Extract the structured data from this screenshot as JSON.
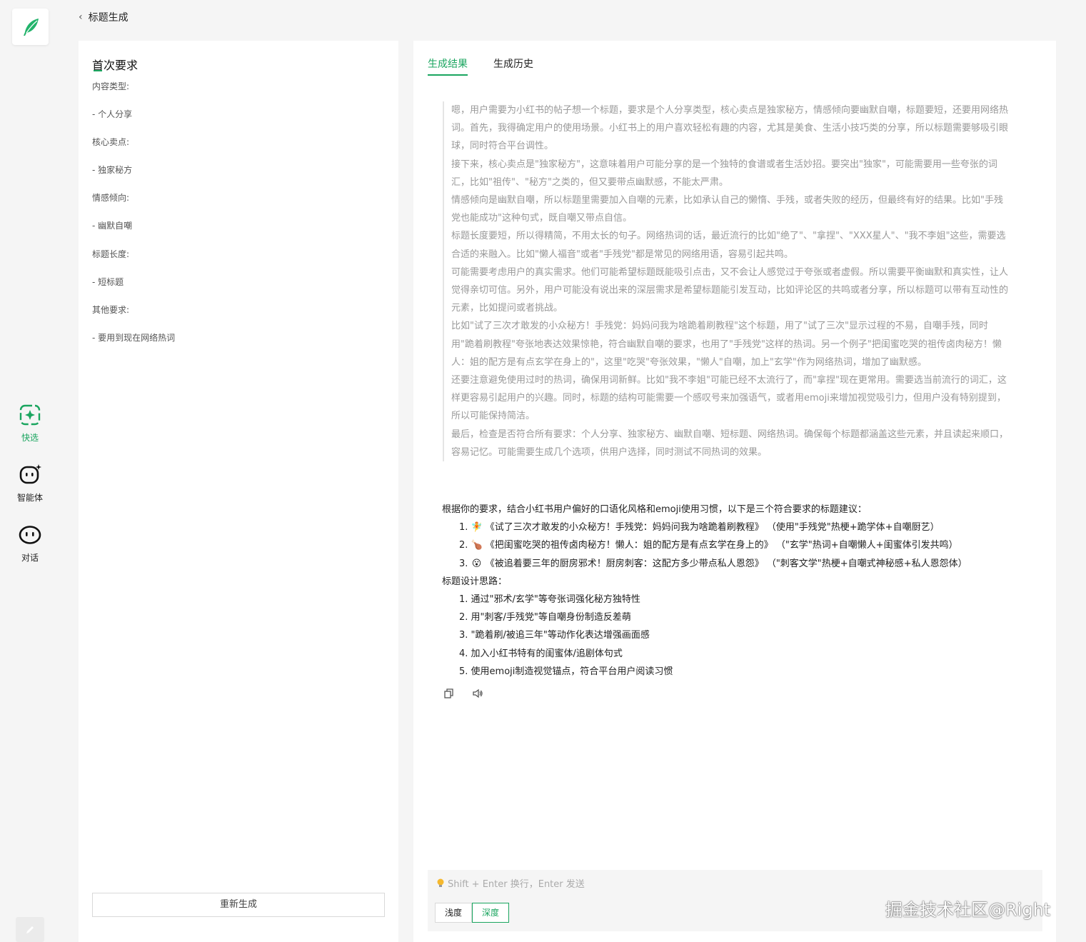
{
  "header": {
    "back_label": "标题生成"
  },
  "rail": {
    "items": [
      {
        "label": "快选",
        "icon": "quick-select-icon"
      },
      {
        "label": "智能体",
        "icon": "agent-icon"
      },
      {
        "label": "对话",
        "icon": "chat-icon"
      }
    ],
    "accent": "#1aa55f"
  },
  "requirements": {
    "title": "首次要求",
    "lines": [
      "内容类型:",
      "- 个人分享",
      "核心卖点:",
      "- 独家秘方",
      "情感倾向:",
      "- 幽默自嘲",
      "标题长度:",
      "- 短标题",
      "其他要求:",
      "- 要用到现在网络热词"
    ],
    "regen_label": "重新生成"
  },
  "result": {
    "tabs": [
      "生成结果",
      "生成历史"
    ],
    "thinking": [
      "嗯，用户需要为小红书的帖子想一个标题，要求是个人分享类型，核心卖点是独家秘方，情感倾向要幽默自嘲，标题要短，还要用网络热词。首先，我得确定用户的使用场景。小红书上的用户喜欢轻松有趣的内容，尤其是美食、生活小技巧类的分享，所以标题需要够吸引眼球，同时符合平台调性。",
      "接下来，核心卖点是\"独家秘方\"，这意味着用户可能分享的是一个独特的食谱或者生活妙招。要突出\"独家\"，可能需要用一些夸张的词汇，比如\"祖传\"、\"秘方\"之类的，但又要带点幽默感，不能太严肃。",
      "情感倾向是幽默自嘲，所以标题里需要加入自嘲的元素，比如承认自己的懒惰、手残，或者失败的经历，但最终有好的结果。比如\"手残党也能成功\"这种句式，既自嘲又带点自信。",
      "标题长度要短，所以得精简，不用太长的句子。网络热词的话，最近流行的比如\"绝了\"、\"拿捏\"、\"XXX星人\"、\"我不李姐\"这些，需要选合适的来融入。比如\"懒人福音\"或者\"手残党\"都是常见的网络用语，容易引起共鸣。",
      "可能需要考虑用户的真实需求。他们可能希望标题既能吸引点击，又不会让人感觉过于夸张或者虚假。所以需要平衡幽默和真实性，让人觉得亲切可信。另外，用户可能没有说出来的深层需求是希望标题能引发互动，比如评论区的共鸣或者分享，所以标题可以带有互动性的元素，比如提问或者挑战。",
      "比如\"试了三次才敢发的小众秘方！手残党：妈妈问我为啥跪着刷教程\"这个标题，用了\"试了三次\"显示过程的不易，自嘲手残，同时用\"跪着刷教程\"夸张地表达效果惊艳，符合幽默自嘲的要求，也用了\"手残党\"这样的热词。另一个例子\"把闺蜜吃哭的祖传卤肉秘方！懒人：姐的配方是有点玄学在身上的\"，这里\"吃哭\"夸张效果，\"懒人\"自嘲，加上\"玄学\"作为网络热词，增加了幽默感。",
      "还要注意避免使用过时的热词，确保用词新鲜。比如\"我不李姐\"可能已经不太流行了，而\"拿捏\"现在更常用。需要选当前流行的词汇，这样更容易引起用户的兴趣。同时，标题的结构可能需要一个感叹号来加强语气，或者用emoji来增加视觉吸引力，但用户没有特别提到，所以可能保持简洁。",
      "最后，检查是否符合所有要求：个人分享、独家秘方、幽默自嘲、短标题、网络热词。确保每个标题都涵盖这些元素，并且读起来顺口，容易记忆。可能需要生成几个选项，供用户选择，同时测试不同热词的效果。"
    ],
    "intro": "根据你的要求，结合小红书用户偏好的口语化风格和emoji使用习惯，以下是三个符合要求的标题建议：",
    "suggestions": [
      {
        "num": "1.",
        "emoji": "🧚",
        "text": "《试了三次才敢发的小众秘方！手残党：妈妈问我为啥跪着刷教程》 （使用\"手残党\"热梗+跪学体+自嘲厨艺）"
      },
      {
        "num": "2.",
        "emoji": "🍗",
        "text": "《把闺蜜吃哭的祖传卤肉秘方！懒人：姐的配方是有点玄学在身上的》 （\"玄学\"热词+自嘲懒人+闺蜜体引发共鸣）"
      },
      {
        "num": "3.",
        "emoji": "😮",
        "text": "《被追着要三年的厨房邪术！厨房刺客：这配方多少带点私人恩怨》 （\"刺客文学\"热梗+自嘲式神秘感+私人恩怨体）"
      }
    ],
    "design_title": "标题设计思路：",
    "design_points": [
      "1. 通过\"邪术/玄学\"等夸张词强化秘方独特性",
      "2. 用\"刺客/手残党\"等自嘲身份制造反差萌",
      "3. \"跪着刷/被追三年\"等动作化表达增强画面感",
      "4. 加入小红书特有的闺蜜体/追剧体句式",
      "5. 使用emoji制造视觉锚点，符合平台用户阅读习惯"
    ]
  },
  "input": {
    "placeholder": "Shift + Enter 换行，Enter 发送",
    "modes": [
      "浅度",
      "深度"
    ]
  },
  "watermark": "掘金技术社区@Right"
}
